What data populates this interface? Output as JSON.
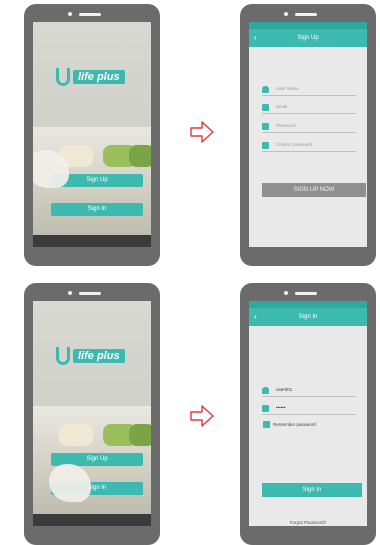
{
  "splash": {
    "logo_text": "life plus",
    "signup_button": "Sign Up",
    "signin_button": "Sign In"
  },
  "signup_screen": {
    "title": "Sign Up",
    "fields": [
      {
        "placeholder": "User Name"
      },
      {
        "placeholder": "Email"
      },
      {
        "placeholder": "Password"
      },
      {
        "placeholder": "Confirm password"
      }
    ],
    "submit_button": "SIGN UP NOW"
  },
  "signin_screen": {
    "title": "Sign In",
    "username_value": "user001",
    "password_value": "••••••",
    "remember_label": "Remember password",
    "login_button": "Sign In",
    "forgot_link": "Forgot Password?"
  },
  "colors": {
    "accent": "#3dbab0",
    "arrow": "#e03a3a",
    "phone_frame": "#6b6b6b"
  },
  "icons": {
    "arrow": "right-arrow-outline-icon",
    "user": "user-icon",
    "email": "email-icon",
    "lock": "lock-icon",
    "check": "checkbox-icon"
  }
}
